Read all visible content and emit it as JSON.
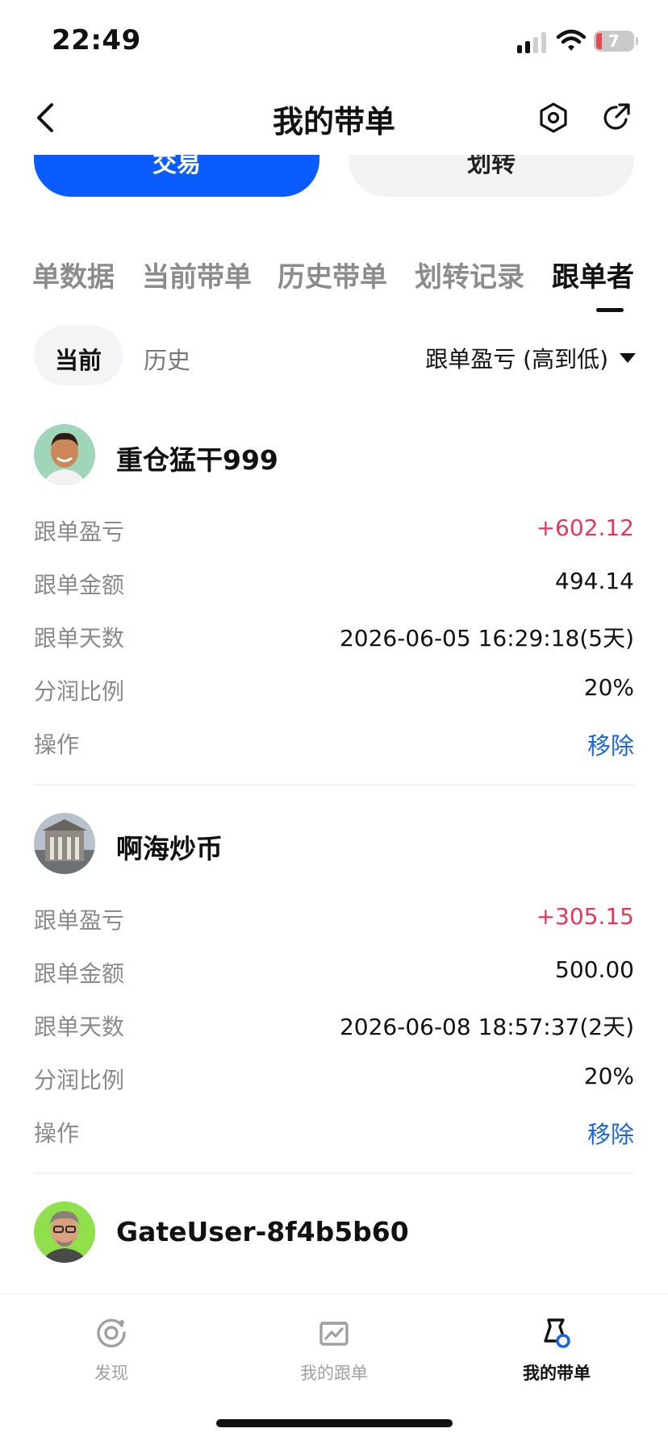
{
  "status_bar": {
    "time": "22:49",
    "battery_level": "7",
    "icons": [
      "signal-icon",
      "wifi-icon",
      "battery-icon"
    ]
  },
  "nav": {
    "title": "我的带单",
    "back_icon": "chevron-left-icon",
    "settings_icon": "hexagon-settings-icon",
    "share_icon": "share-icon"
  },
  "actions": {
    "trade_label": "交易",
    "transfer_label": "划转"
  },
  "tabs": [
    {
      "label": "单数据",
      "active": false
    },
    {
      "label": "当前带单",
      "active": false
    },
    {
      "label": "历史带单",
      "active": false
    },
    {
      "label": "划转记录",
      "active": false
    },
    {
      "label": "跟单者",
      "active": true
    }
  ],
  "filter": {
    "current": "当前",
    "history": "历史",
    "sort": "跟单盈亏 (高到低)"
  },
  "labels": {
    "pnl": "跟单盈亏",
    "amount": "跟单金额",
    "days": "跟单天数",
    "share_ratio": "分润比例",
    "operation": "操作",
    "remove": "移除"
  },
  "followers": [
    {
      "name": "重仓猛干999",
      "pnl": "+602.12",
      "amount": "494.14",
      "days": "2026-06-05 16:29:18(5天)",
      "share_ratio": "20%"
    },
    {
      "name": "啊海炒币",
      "pnl": "+305.15",
      "amount": "500.00",
      "days": "2026-06-08 18:57:37(2天)",
      "share_ratio": "20%"
    },
    {
      "name": "GateUser-8f4b5b60"
    }
  ],
  "bottom_nav": [
    {
      "label": "发现",
      "icon": "discover-icon",
      "active": false
    },
    {
      "label": "我的跟单",
      "icon": "copy-trading-icon",
      "active": false
    },
    {
      "label": "我的带单",
      "icon": "lead-trading-icon",
      "active": true
    }
  ],
  "colors": {
    "brand_blue": "#0a5cff",
    "profit_red": "#e5375b",
    "link_blue": "#1a66d8"
  }
}
